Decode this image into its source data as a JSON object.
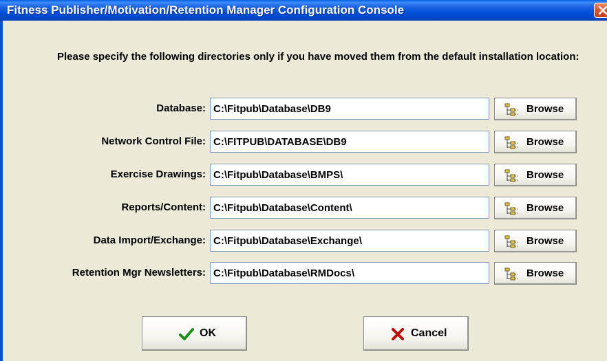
{
  "window": {
    "title": "Fitness Publisher/Motivation/Retention Manager Configuration Console"
  },
  "instructions": "Please specify the following directories only if you have moved them from the default installation location:",
  "fields": [
    {
      "label": "Database:",
      "value": "C:\\Fitpub\\Database\\DB9",
      "browse_label": "Browse"
    },
    {
      "label": "Network Control File:",
      "value": "C:\\FITPUB\\DATABASE\\DB9",
      "browse_label": "Browse"
    },
    {
      "label": "Exercise Drawings:",
      "value": "C:\\Fitpub\\Database\\BMPS\\",
      "browse_label": "Browse"
    },
    {
      "label": "Reports/Content:",
      "value": "C:\\Fitpub\\Database\\Content\\",
      "browse_label": "Browse"
    },
    {
      "label": "Data Import/Exchange:",
      "value": "C:\\Fitpub\\Database\\Exchange\\",
      "browse_label": "Browse"
    },
    {
      "label": "Retention Mgr Newsletters:",
      "value": "C:\\Fitpub\\Database\\RMDocs\\",
      "browse_label": "Browse"
    }
  ],
  "buttons": {
    "ok_label": "OK",
    "cancel_label": "Cancel"
  },
  "icons": {
    "close": "close-icon",
    "browse": "folder-tree-icon",
    "ok": "checkmark-icon",
    "cancel": "x-mark-icon"
  },
  "colors": {
    "titlebar": "#0050D8",
    "dialog_bg": "#ECE9D8",
    "close_button": "#D9552F",
    "ok_check": "#1A8F1A",
    "cancel_x": "#C00000"
  }
}
